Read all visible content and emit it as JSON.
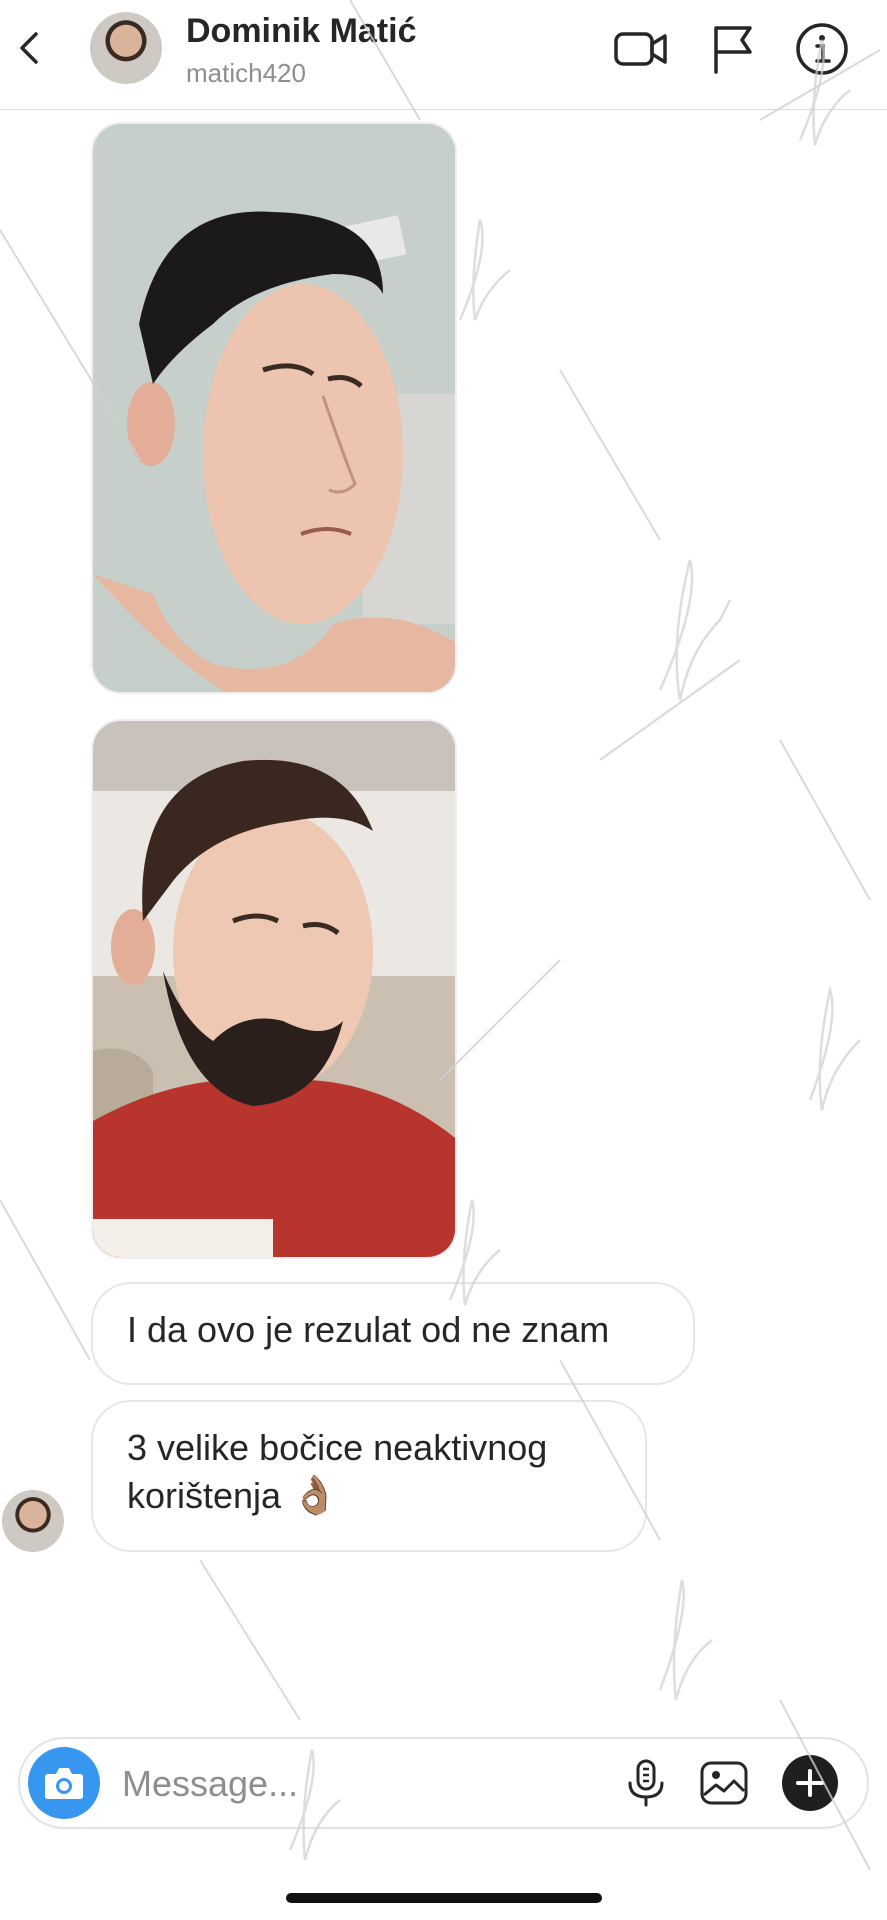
{
  "header": {
    "name": "Dominik Matić",
    "username": "matich420",
    "icons": [
      "chevron-left-icon",
      "video-camera-icon",
      "flag-icon",
      "info-icon"
    ]
  },
  "messages": [
    {
      "type": "photo",
      "content": "selfie-before-photo"
    },
    {
      "type": "photo",
      "content": "selfie-after-photo"
    },
    {
      "type": "text",
      "text": "I da ovo je rezulat od ne znam"
    },
    {
      "type": "text",
      "text": "3 velike bočice neaktivnog korištenja",
      "emoji": "👌🏽"
    }
  ],
  "composer": {
    "placeholder": "Message...",
    "icons": [
      "camera-icon",
      "microphone-icon",
      "gallery-icon",
      "plus-icon"
    ]
  },
  "colors": {
    "accent": "#3797f0",
    "text": "#262626",
    "muted": "#8e8e8e",
    "border": "#dbdbdb"
  }
}
